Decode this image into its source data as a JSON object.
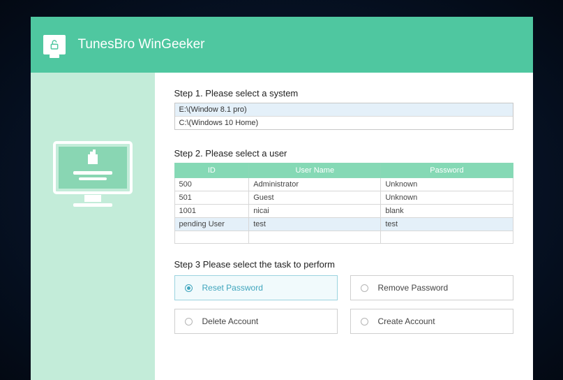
{
  "app_title": "TunesBro WinGeeker",
  "steps": {
    "step1": {
      "label": "Step 1. Please select a system",
      "systems": [
        {
          "path": "E:\\(Window 8.1 pro)",
          "selected": true
        },
        {
          "path": "C:\\(Windows 10 Home)",
          "selected": false
        }
      ]
    },
    "step2": {
      "label": "Step 2. Please select a user",
      "columns": {
        "id": "ID",
        "username": "User Name",
        "password": "Password"
      },
      "users": [
        {
          "id": "500",
          "username": "Administrator",
          "password": "Unknown",
          "selected": false
        },
        {
          "id": "501",
          "username": "Guest",
          "password": "Unknown",
          "selected": false
        },
        {
          "id": "1001",
          "username": "nicai",
          "password": "blank",
          "selected": false
        },
        {
          "id": "pending User",
          "username": "test",
          "password": "test",
          "selected": true
        }
      ]
    },
    "step3": {
      "label": "Step 3  Please select the task to perform",
      "tasks": [
        {
          "label": "Reset Password",
          "selected": true
        },
        {
          "label": "Remove Password",
          "selected": false
        },
        {
          "label": "Delete Account",
          "selected": false
        },
        {
          "label": "Create Account",
          "selected": false
        }
      ]
    }
  },
  "colors": {
    "accent": "#4fc7a0",
    "panel": "#c3ecd9",
    "select": "#e4f0f9"
  }
}
